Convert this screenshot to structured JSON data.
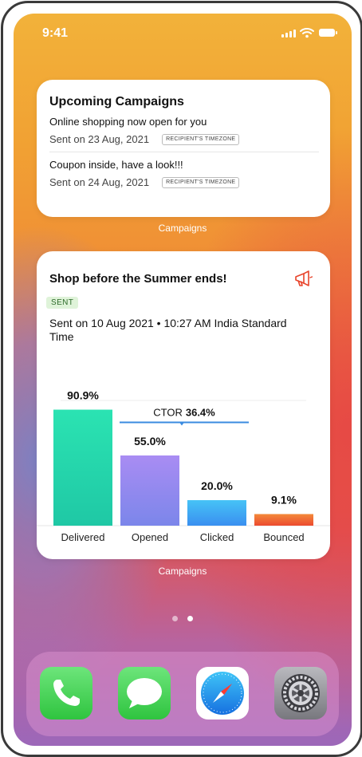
{
  "status_bar": {
    "time": "9:41"
  },
  "widget_upcoming": {
    "title": "Upcoming Campaigns",
    "campaigns": [
      {
        "name": "Online shopping now open for you",
        "sent": "Sent on 23 Aug, 2021",
        "tag": "RECIPIENT'S TIMEZONE"
      },
      {
        "name": "Coupon inside, have a look!!!",
        "sent": "Sent on 24 Aug, 2021",
        "tag": "RECIPIENT'S TIMEZONE"
      }
    ],
    "label": "Campaigns"
  },
  "widget_detail": {
    "title": "Shop before the Summer ends!",
    "status": "SENT",
    "sent_detail": "Sent on 10 Aug 2021 • 10:27 AM India Standard Time",
    "label": "Campaigns"
  },
  "chart_data": {
    "type": "bar",
    "categories": [
      "Delivered",
      "Opened",
      "Clicked",
      "Bounced"
    ],
    "values": [
      90.9,
      55.0,
      20.0,
      9.1
    ],
    "value_labels": [
      "90.9%",
      "55.0%",
      "20.0%",
      "9.1%"
    ],
    "ylim": [
      0,
      100
    ],
    "annotation": {
      "label": "CTOR",
      "value": "36.4%"
    },
    "colors": {
      "Delivered": [
        "#2be3b2",
        "#1fc8a5"
      ],
      "Opened": [
        "#a98cf3",
        "#7b86ea"
      ],
      "Clicked": [
        "#46c3f6",
        "#3a8ff0"
      ],
      "Bounced": [
        "#f38a3a",
        "#ec4a2f"
      ]
    },
    "ctor_color": "#3a8be0"
  },
  "page_indicator": {
    "pages": 2,
    "active": 1
  },
  "dock": {
    "apps": [
      {
        "name": "Phone",
        "icon": "phone-icon"
      },
      {
        "name": "Messages",
        "icon": "messages-icon"
      },
      {
        "name": "Safari",
        "icon": "safari-icon"
      },
      {
        "name": "Settings",
        "icon": "settings-icon"
      }
    ]
  },
  "colors": {
    "accent_megaphone": "#e8442b",
    "sent_badge_bg": "#dff3d9",
    "sent_badge_text": "#2e6b2a"
  }
}
